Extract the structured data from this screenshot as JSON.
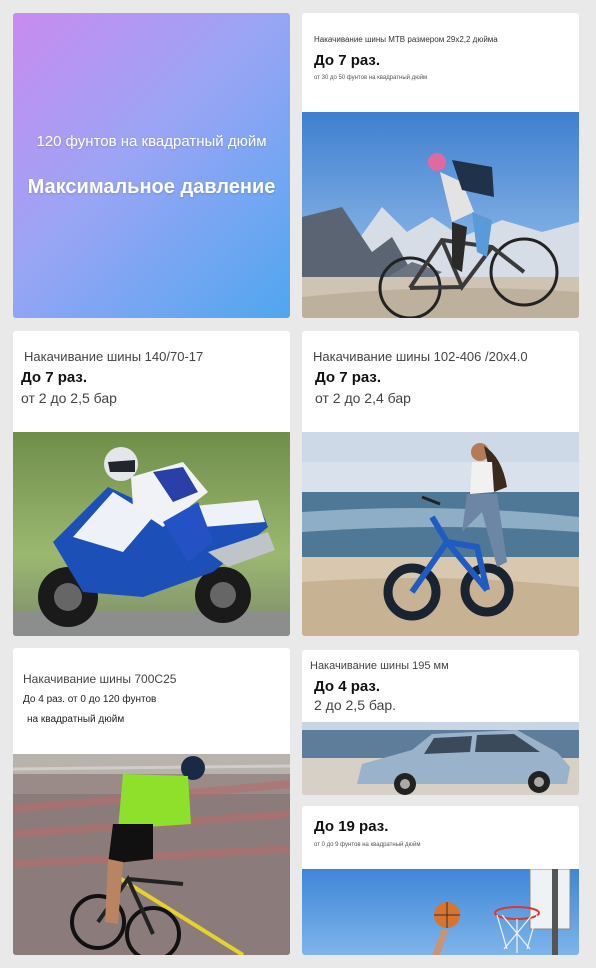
{
  "hero": {
    "subtitle": "120 фунтов на квадратный дюйм",
    "title": "Максимальное давление"
  },
  "cards": {
    "mtb": {
      "heading": "Накачивание шины MTB размером 29x2,2 дюйма",
      "count": "До 7 раз.",
      "range": "от 30 до 50 фунтов на квадратный дюйм"
    },
    "moto": {
      "heading": "Накачивание шины 140/70-17",
      "count": "До 7 раз.",
      "range": "от 2 до 2,5 бар"
    },
    "fatbike": {
      "heading": "Накачивание шины 102-406 /20x4.0",
      "count": "До 7 раз.",
      "range": "от 2 до 2,4 бар"
    },
    "road": {
      "heading": "Накачивание шины 700C25",
      "count": "До 4 раз. от 0 до 120 фунтов",
      "range": "на квадратный дюйм"
    },
    "car": {
      "heading": "Накачивание шины 195 мм",
      "count": "До 4 раз.",
      "range": "2 до 2,5 бар."
    },
    "ball": {
      "count": "До 19 раз.",
      "range": "от 0 до 9 фунтов на квадратный дюйм"
    }
  }
}
